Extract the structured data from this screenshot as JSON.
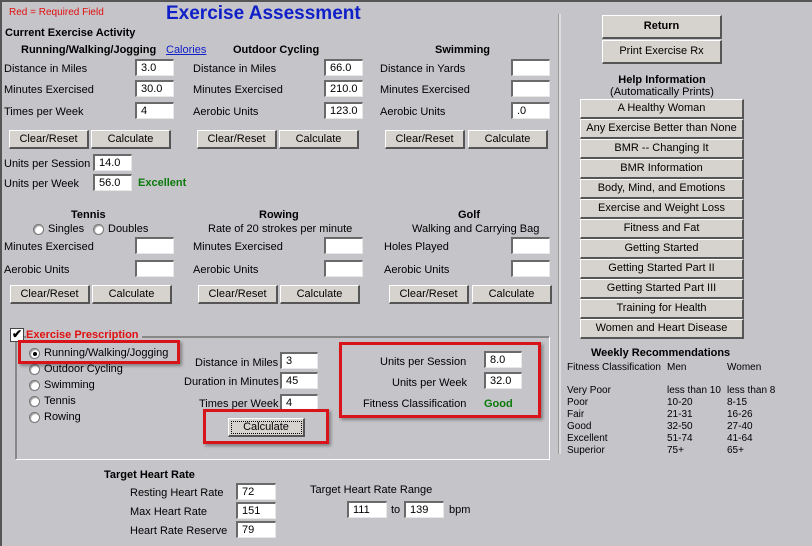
{
  "header": {
    "required_note": "Red = Required Field",
    "title": "Exercise Assessment",
    "section_title": "Current Exercise Activity"
  },
  "colors": {
    "title": "#1020c8",
    "required": "#e01010",
    "good": "#0a7a0a",
    "highlight_box": "#d8131a",
    "background": "#c5c4c9"
  },
  "running": {
    "title": "Running/Walking/Jogging",
    "calories_link": "Calories",
    "distance_label": "Distance in Miles",
    "distance_value": "3.0",
    "minutes_label": "Minutes Exercised",
    "minutes_value": "30.0",
    "times_label": "Times per Week",
    "times_value": "4",
    "clear_label": "Clear/Reset",
    "calc_label": "Calculate",
    "units_session_label": "Units per Session",
    "units_session_value": "14.0",
    "units_week_label": "Units per Week",
    "units_week_value": "56.0",
    "classification": "Excellent"
  },
  "cycling": {
    "title": "Outdoor Cycling",
    "distance_label": "Distance in Miles",
    "distance_value": "66.0",
    "minutes_label": "Minutes Exercised",
    "minutes_value": "210.0",
    "aerobic_label": "Aerobic Units",
    "aerobic_value": "123.0",
    "clear_label": "Clear/Reset",
    "calc_label": "Calculate"
  },
  "swimming": {
    "title": "Swimming",
    "distance_label": "Distance in Yards",
    "distance_value": "",
    "minutes_label": "Minutes Exercised",
    "minutes_value": "",
    "aerobic_label": "Aerobic Units",
    "aerobic_value": ".0",
    "clear_label": "Clear/Reset",
    "calc_label": "Calculate"
  },
  "tennis": {
    "title": "Tennis",
    "singles_label": "Singles",
    "doubles_label": "Doubles",
    "minutes_label": "Minutes Exercised",
    "minutes_value": "",
    "aerobic_label": "Aerobic Units",
    "aerobic_value": "",
    "clear_label": "Clear/Reset",
    "calc_label": "Calculate"
  },
  "rowing": {
    "title": "Rowing",
    "subtitle": "Rate of 20 strokes per minute",
    "minutes_label": "Minutes Exercised",
    "minutes_value": "",
    "aerobic_label": "Aerobic Units",
    "aerobic_value": "",
    "clear_label": "Clear/Reset",
    "calc_label": "Calculate"
  },
  "golf": {
    "title": "Golf",
    "subtitle": "Walking and Carrying Bag",
    "holes_label": "Holes Played",
    "holes_value": "",
    "aerobic_label": "Aerobic Units",
    "aerobic_value": "",
    "clear_label": "Clear/Reset",
    "calc_label": "Calculate"
  },
  "prescription": {
    "title": "Exercise Prescription",
    "checked": true,
    "options": [
      "Running/Walking/Jogging",
      "Outdoor Cycling",
      "Swimming",
      "Tennis",
      "Rowing"
    ],
    "selected": "Running/Walking/Jogging",
    "distance_label": "Distance in Miles",
    "distance_value": "3",
    "duration_label": "Duration in Minutes",
    "duration_value": "45",
    "times_label": "Times per Week",
    "times_value": "4",
    "calc_label": "Calculate",
    "units_session_label": "Units per Session",
    "units_session_value": "8.0",
    "units_week_label": "Units per Week",
    "units_week_value": "32.0",
    "fitness_label": "Fitness Classification",
    "fitness_value": "Good"
  },
  "heart_rate": {
    "title": "Target Heart Rate",
    "resting_label": "Resting Heart Rate",
    "resting_value": "72",
    "max_label": "Max Heart Rate",
    "max_value": "151",
    "reserve_label": "Heart Rate Reserve",
    "reserve_value": "79",
    "range_label": "Target Heart Rate Range",
    "range_low": "111",
    "range_to": "to",
    "range_high": "139",
    "range_unit": "bpm"
  },
  "side": {
    "return_label": "Return",
    "print_label": "Print Exercise Rx",
    "help_title": "Help Information",
    "help_subtitle": "(Automatically Prints)",
    "help_items": [
      "A Healthy Woman",
      "Any Exercise Better than None",
      "BMR -- Changing It",
      "BMR Information",
      "Body, Mind, and Emotions",
      "Exercise and Weight Loss",
      "Fitness and Fat",
      "Getting Started",
      "Getting Started Part II",
      "Getting Started Part III",
      "Training for Health",
      "Women and Heart Disease"
    ]
  },
  "weekly": {
    "title": "Weekly Recommendations",
    "headers": [
      "Fitness Classification",
      "Men",
      "Women"
    ],
    "rows": [
      [
        "Very Poor",
        "less than 10",
        "less than 8"
      ],
      [
        "Poor",
        "10-20",
        "8-15"
      ],
      [
        "Fair",
        "21-31",
        "16-26"
      ],
      [
        "Good",
        "32-50",
        "27-40"
      ],
      [
        "Excellent",
        "51-74",
        "41-64"
      ],
      [
        "Superior",
        "75+",
        "65+"
      ]
    ]
  }
}
